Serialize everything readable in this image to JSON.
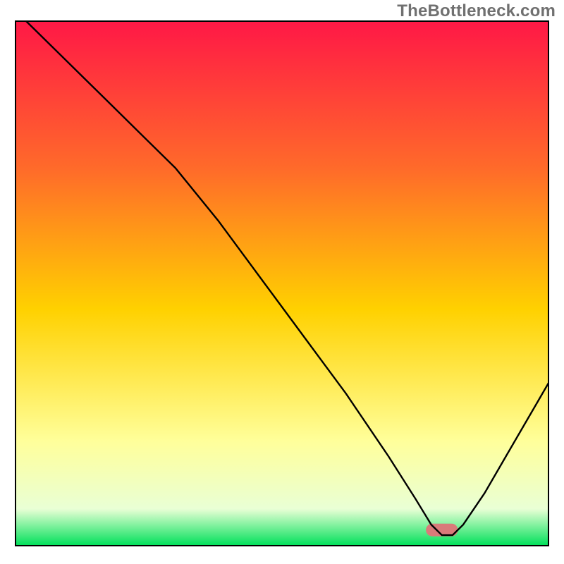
{
  "watermark": "TheBottleneck.com",
  "chart_data": {
    "type": "line",
    "title": "",
    "subtitle": "",
    "xlabel": "",
    "ylabel": "",
    "xlim": [
      0,
      100
    ],
    "ylim": [
      0,
      100
    ],
    "grid": false,
    "legend": false,
    "annotations": [],
    "background_gradient": {
      "top": "#ff1846",
      "upper": "#ff6a2a",
      "mid": "#ffd100",
      "lower_soft": "#ffff9a",
      "lower_pale": "#e9ffd5",
      "bottom": "#00e05a"
    },
    "marker": {
      "x_range": [
        77,
        83
      ],
      "y": 3,
      "width_pct": 6,
      "color": "#d97a7a",
      "shape": "rounded-bar"
    },
    "series": [
      {
        "name": "bottleneck-curve",
        "color": "#000000",
        "stroke_width": 2.4,
        "x": [
          2,
          10,
          18,
          24,
          30,
          38,
          46,
          54,
          62,
          70,
          75,
          78,
          80,
          82,
          84,
          88,
          92,
          96,
          100
        ],
        "y": [
          100,
          92,
          84,
          78,
          72,
          62,
          51,
          40,
          29,
          17,
          9,
          4,
          2,
          2,
          4,
          10,
          17,
          24,
          31
        ]
      }
    ]
  }
}
